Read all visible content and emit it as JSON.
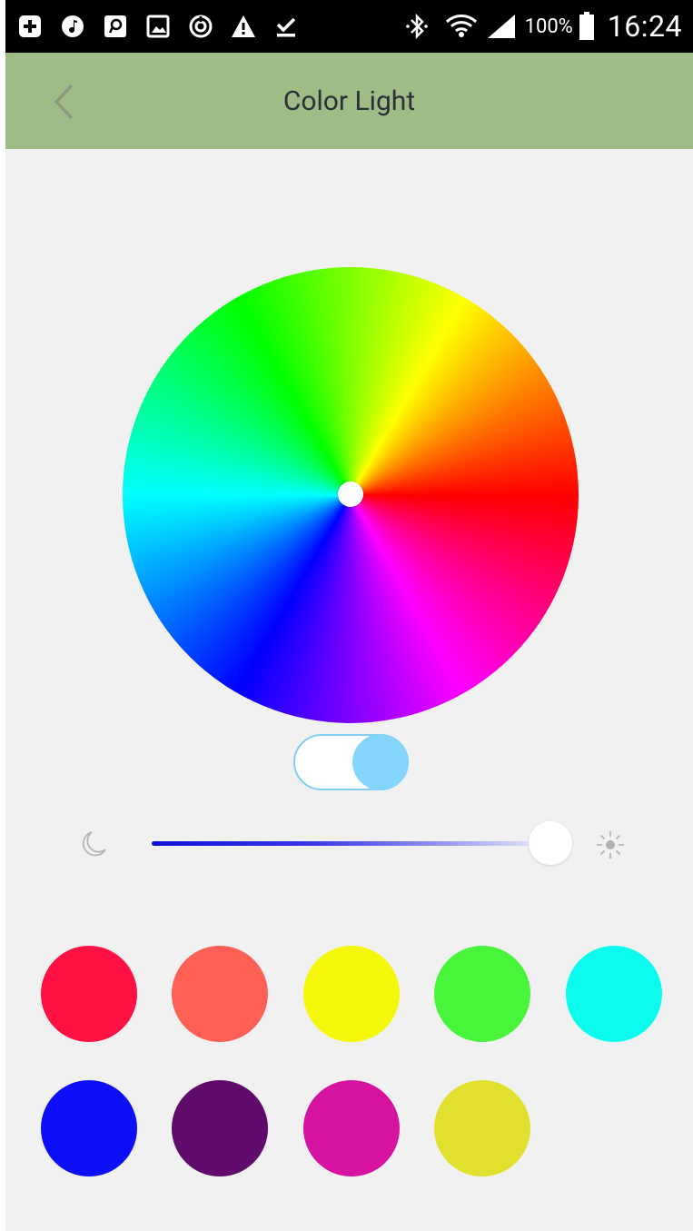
{
  "status_bar": {
    "battery_percent": "100%",
    "time": "16:24",
    "icons": [
      "add-box-icon",
      "music-note-icon",
      "screen-mirror-icon",
      "image-icon",
      "sync-icon",
      "warning-icon",
      "download-done-icon",
      "bluetooth-icon",
      "wifi-icon",
      "signal-icon",
      "battery-icon"
    ]
  },
  "header": {
    "title": "Color Light",
    "back_icon": "chevron-left-icon",
    "background": "#9ebc85"
  },
  "color_wheel": {
    "hue_stops": [
      "#ff0000",
      "#ff00ff",
      "#0000ff",
      "#00ffff",
      "#00ff00",
      "#ffff00"
    ]
  },
  "toggle": {
    "state": "on",
    "accent": "#84d4fb"
  },
  "brightness": {
    "level_percent": 100,
    "min_icon": "moon-icon",
    "max_icon": "sun-icon"
  },
  "swatches": [
    {
      "color": "#ff1144"
    },
    {
      "color": "#ff6055"
    },
    {
      "color": "#f5f70a"
    },
    {
      "color": "#48f53b"
    },
    {
      "color": "#0bfcef"
    },
    {
      "color": "#0c0ff7"
    },
    {
      "color": "#600b6c"
    },
    {
      "color": "#d613a0"
    },
    {
      "color": "#e2e02e"
    }
  ]
}
